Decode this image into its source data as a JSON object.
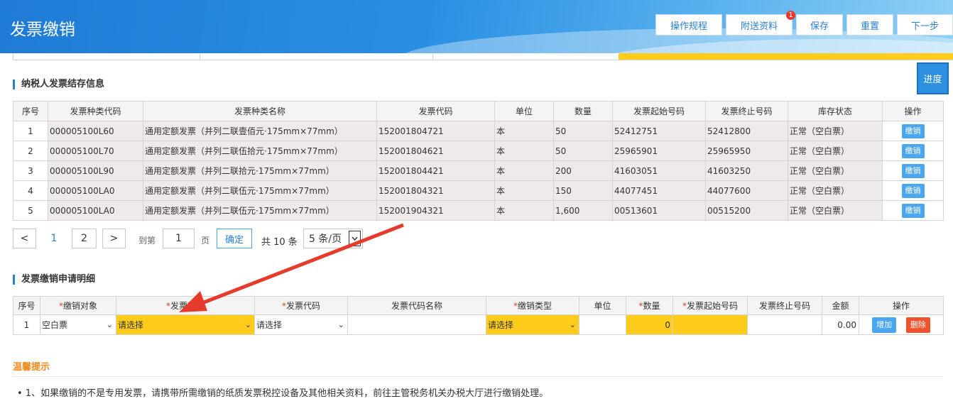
{
  "header": {
    "title": "发票缴销",
    "buttons": [
      "操作规程",
      "附送资料",
      "保存",
      "重置",
      "下一步"
    ],
    "badge": "1"
  },
  "side": {
    "progress_label": "进度"
  },
  "stock": {
    "section_title": "纳税人发票结存信息",
    "columns": [
      "序号",
      "发票种类代码",
      "发票种类名称",
      "发票代码",
      "单位",
      "数量",
      "发票起始号码",
      "发票终止号码",
      "库存状态",
      "操作"
    ],
    "rows": [
      {
        "no": "1",
        "type_code": "000005100L60",
        "type_name": "通用定额发票（并列二联壹佰元·175mm×77mm）",
        "code": "152001804721",
        "unit": "本",
        "qty": "50",
        "start": "52412751",
        "end": "52412800",
        "status": "正常（空白票）",
        "action": "缴销"
      },
      {
        "no": "2",
        "type_code": "000005100L70",
        "type_name": "通用定额发票（并列二联伍拾元·175mm×77mm）",
        "code": "152001804621",
        "unit": "本",
        "qty": "50",
        "start": "25965901",
        "end": "25965950",
        "status": "正常（空白票）",
        "action": "缴销"
      },
      {
        "no": "3",
        "type_code": "000005100L90",
        "type_name": "通用定额发票（并列二联拾元·175mm×77mm）",
        "code": "152001804421",
        "unit": "本",
        "qty": "200",
        "start": "41603051",
        "end": "41603250",
        "status": "正常（空白票）",
        "action": "缴销"
      },
      {
        "no": "4",
        "type_code": "000005100LA0",
        "type_name": "通用定额发票（并列二联伍元·175mm×77mm）",
        "code": "152001804321",
        "unit": "本",
        "qty": "150",
        "start": "44077451",
        "end": "44077600",
        "status": "正常（空白票）",
        "action": "缴销"
      },
      {
        "no": "5",
        "type_code": "000005100LA0",
        "type_name": "通用定额发票（并列二联伍元·175mm×77mm）",
        "code": "152001904321",
        "unit": "本",
        "qty": "1,600",
        "start": "00513601",
        "end": "00515200",
        "status": "正常（空白票）",
        "action": "缴销"
      }
    ]
  },
  "pagination": {
    "prev": "<",
    "page1": "1",
    "page2": "2",
    "next": ">",
    "goto_label": "到第",
    "goto_value": "1",
    "page_label": "页",
    "confirm": "确定",
    "total": "共 10 条",
    "page_size": "5 条/页"
  },
  "apply": {
    "section_title": "发票缴销申请明细",
    "columns": {
      "no": "序号",
      "target": "缴销对象",
      "type": "发票种类",
      "code": "发票代码",
      "code_name": "发票代码名称",
      "cancel_type": "缴销类型",
      "unit": "单位",
      "qty": "数量",
      "start": "发票起始号码",
      "end": "发票终止号码",
      "amount": "金额",
      "op": "操作"
    },
    "required_mark": "*",
    "row": {
      "no": "1",
      "target": "空白票",
      "type": "请选择",
      "code": "请选择",
      "cancel_type": "请选择",
      "qty": "0",
      "amount": "0.00",
      "add": "增加",
      "delete": "删除"
    }
  },
  "tips": {
    "title": "温馨提示",
    "items": [
      "• 1、如果缴销的不是专用发票，请携带所需缴销的纸质发票税控设备及其他相关资料，前往主管税务机关办税大厅进行缴销处理。"
    ]
  },
  "colors": {
    "header_blue": "#2a8fe3",
    "highlight_yellow": "#ffcc1c",
    "action_blue": "#4aa6ef",
    "delete_red": "#f0522d",
    "arrow_red": "#e53b2c",
    "tip_orange": "#f08a1c"
  }
}
